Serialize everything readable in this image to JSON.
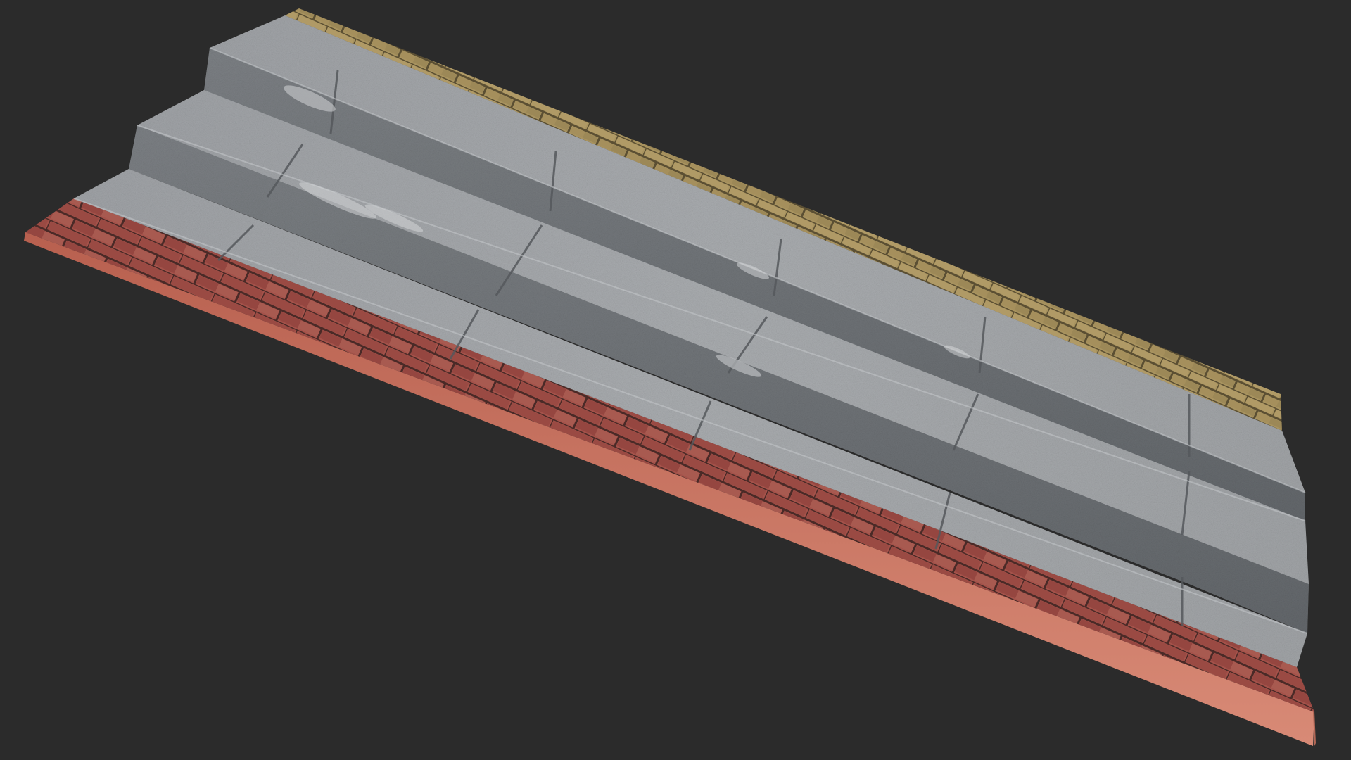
{
  "scene": {
    "subject": "stairs-model",
    "colors": {
      "background": "#2b2b2b",
      "granite_light": "#a3a6a9",
      "granite_mid": "#8d9094",
      "granite_dark": "#707478",
      "granite_riser": "#6b6e72",
      "red_brick": "#a4524a",
      "red_brick_dark": "#6d3530",
      "red_mortar": "#4a2a27",
      "red_side": "#c97462",
      "yellow_brick": "#a8935f",
      "yellow_mortar": "#5b4f33"
    }
  }
}
